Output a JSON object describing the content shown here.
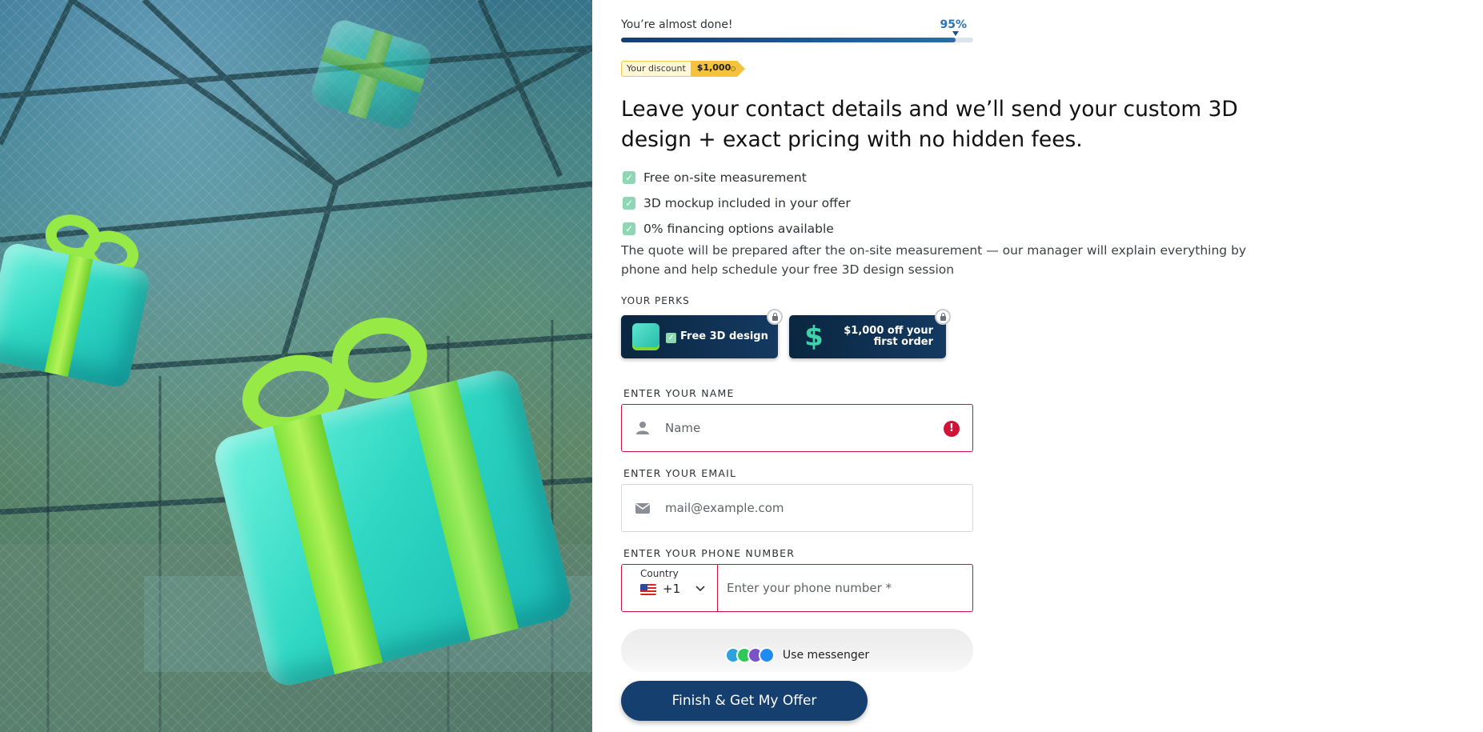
{
  "progress": {
    "text": "You’re almost done!",
    "percent_label": "95%",
    "value": 0.95
  },
  "discount": {
    "label": "Your discount",
    "value": "$1,000"
  },
  "headline": "Leave your contact details and we’ll send your custom 3D design + exact pricing with no hidden fees.",
  "benefits": [
    {
      "label": "Free on-site measurement",
      "icon": "checkbox-icon"
    },
    {
      "label": "3D mockup included in your offer",
      "icon": "checkbox-icon"
    },
    {
      "label": "0% financing options available",
      "icon": "checkbox-icon"
    }
  ],
  "note": "The quote will be prepared after the on-site measurement — our manager will explain everything by phone and help schedule your free 3D design session",
  "perks": {
    "title": "YOUR PERKS",
    "items": [
      {
        "label": "Free 3D design",
        "icon": "gift-icon",
        "locked": true
      },
      {
        "label": "$1,000 off your first order",
        "icon": "dollar-icon",
        "locked": true
      }
    ]
  },
  "form": {
    "name": {
      "label": "ENTER YOUR NAME",
      "placeholder": "Name",
      "value": "",
      "error": true
    },
    "email": {
      "label": "ENTER YOUR EMAIL",
      "placeholder": "mail@example.com",
      "value": ""
    },
    "phone": {
      "label": "ENTER YOUR PHONE NUMBER",
      "country_label": "Country",
      "country_code": "+1",
      "country_flag": "us-flag-icon",
      "placeholder": "Enter your phone number *",
      "value": ""
    }
  },
  "messenger": {
    "label": "Use messenger",
    "icons": [
      "telegram-icon",
      "whatsapp-icon",
      "viber-icon",
      "messenger-icon"
    ]
  },
  "submit_label": "Finish & Get My Offer",
  "colors": {
    "brand": "#153f6f",
    "progress": "#123f6e",
    "accent": "#2a73b8",
    "error": "#c8143c",
    "discount": "#f4c33b",
    "check": "#8fd6b4"
  }
}
